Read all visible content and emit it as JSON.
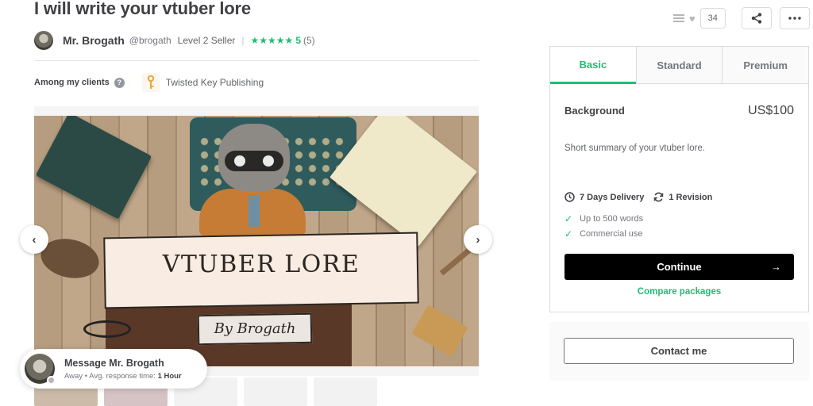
{
  "gig": {
    "title": "I will write your vtuber lore"
  },
  "seller": {
    "name": "Mr. Brogath",
    "handle": "@brogath",
    "level": "Level 2 Seller",
    "separator": "|",
    "stars": "★★★★★",
    "rating": "5",
    "rating_count": "(5)"
  },
  "clients": {
    "label": "Among my clients",
    "help_icon": "?",
    "client_name": "Twisted Key Publishing"
  },
  "gallery": {
    "banner_text": "VTUBER LORE",
    "byline": "By Brogath",
    "prev_icon": "‹",
    "next_icon": "›"
  },
  "message": {
    "title": "Message Mr. Brogath",
    "status": "Away",
    "bullet": "•",
    "response_label": "Avg. response time:",
    "response_value": "1 Hour"
  },
  "actions": {
    "like_count": "34"
  },
  "package": {
    "tabs": [
      "Basic",
      "Standard",
      "Premium"
    ],
    "active_tab": 0,
    "name": "Background",
    "price": "US$100",
    "description": "Short summary of your vtuber lore.",
    "delivery": "7 Days Delivery",
    "revisions": "1 Revision",
    "features": [
      "Up to 500 words",
      "Commercial use"
    ],
    "continue_label": "Continue",
    "continue_arrow": "→",
    "compare_label": "Compare packages"
  },
  "contact": {
    "label": "Contact me"
  },
  "colors": {
    "accent": "#1dbf73",
    "text": "#404145",
    "muted": "#74767e",
    "border": "#dadbdd"
  }
}
